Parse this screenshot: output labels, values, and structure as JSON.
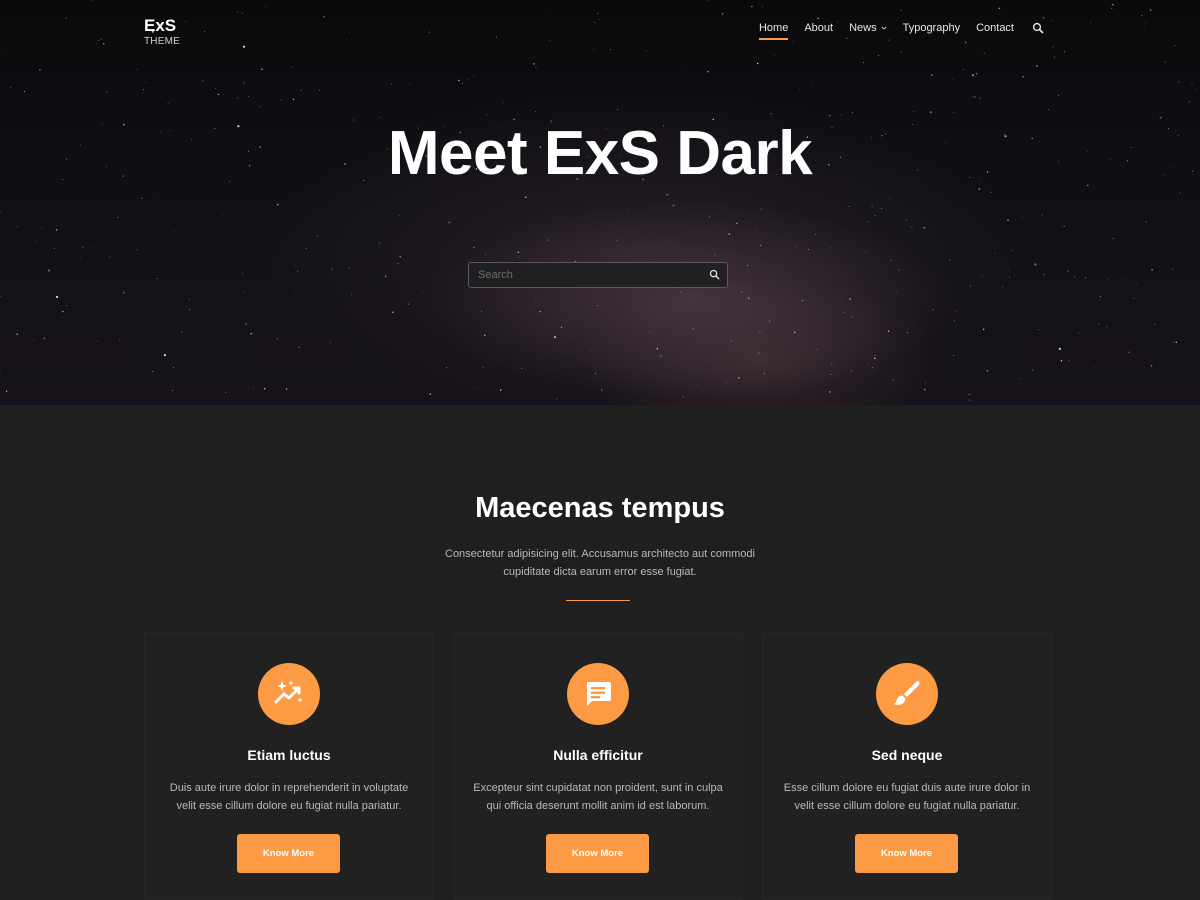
{
  "header": {
    "logo_title": "ExS",
    "logo_subtitle": "THEME",
    "nav": [
      {
        "label": "Home",
        "active": true
      },
      {
        "label": "About"
      },
      {
        "label": "News",
        "dropdown": true
      },
      {
        "label": "Typography"
      },
      {
        "label": "Contact"
      }
    ],
    "search_icon": "search-icon"
  },
  "hero": {
    "title": "Meet ExS Dark",
    "search_placeholder": "Search"
  },
  "features": {
    "title": "Maecenas tempus",
    "description": "Consectetur adipisicing elit. Accusamus architecto aut commodi cupiditate dicta earum error esse fugiat.",
    "cards": [
      {
        "icon": "sparkle-chart-icon",
        "title": "Etiam luctus",
        "text": "Duis aute irure dolor in reprehenderit in voluptate velit esse cillum dolore eu fugiat nulla pariatur.",
        "button": "Know More"
      },
      {
        "icon": "chat-bubble-icon",
        "title": "Nulla efficitur",
        "text": "Excepteur sint cupidatat non proident, sunt in culpa qui officia deserunt mollit anim id est laborum.",
        "button": "Know More"
      },
      {
        "icon": "paint-brush-icon",
        "title": "Sed neque",
        "text": "Esse cillum dolore eu fugiat duis aute irure dolor in velit esse cillum dolore eu fugiat nulla pariatur.",
        "button": "Know More"
      }
    ]
  },
  "colors": {
    "accent": "#fd9b44",
    "background": "#1f1f1f",
    "hero_background": "#0a0a0c"
  }
}
